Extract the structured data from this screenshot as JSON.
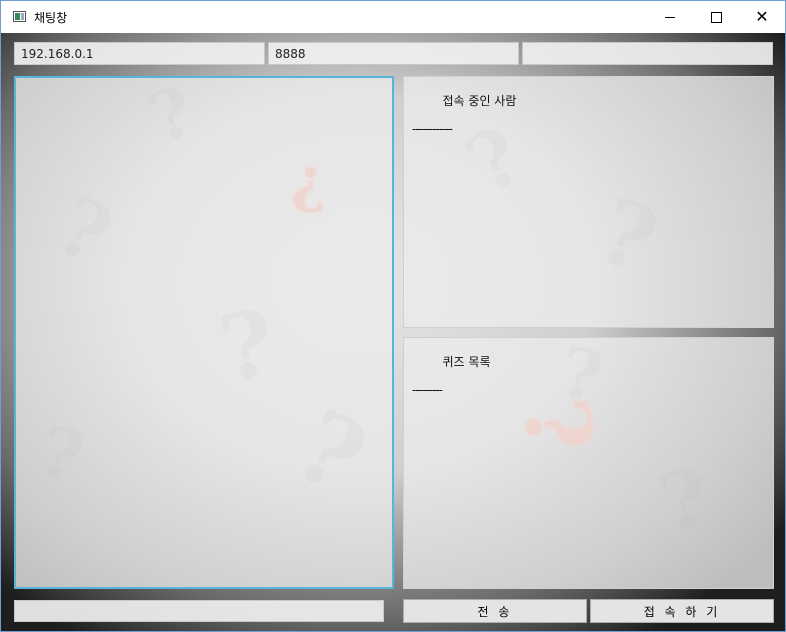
{
  "window": {
    "title": "채팅창",
    "controls": {
      "minimize": "minimize-icon",
      "maximize": "maximize-icon",
      "close": "close-icon"
    }
  },
  "connection": {
    "ip": "192.168.0.1",
    "port": "8888",
    "name": ""
  },
  "chat": {
    "log": ""
  },
  "users": {
    "header": "접속 중인 사람",
    "separator": "------------"
  },
  "quiz": {
    "header": "퀴즈 목록",
    "separator": "---------"
  },
  "message": {
    "value": ""
  },
  "buttons": {
    "send": "전 송",
    "connect": "접 속 하 기"
  },
  "theme": {
    "accent": "#58b4d8",
    "background_dark": "#1e1e1e",
    "highlight": "#ff6e50"
  }
}
